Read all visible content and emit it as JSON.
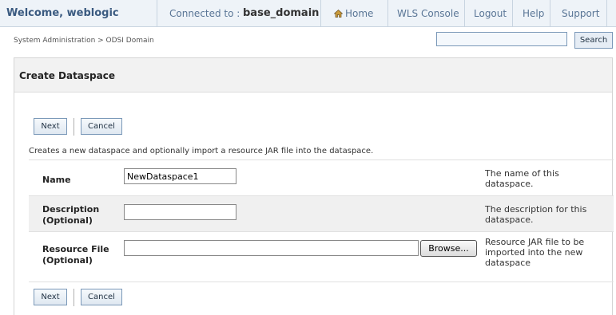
{
  "topbar": {
    "welcome_prefix": "Welcome, ",
    "username": "weblogic",
    "connected_label": "Connected to :",
    "domain": "base_domain",
    "nav": [
      "Home",
      "WLS Console",
      "Logout",
      "Help",
      "Support"
    ]
  },
  "breadcrumb": "System Administration > ODSI Domain",
  "search": {
    "value": "",
    "button_label": "Search"
  },
  "panel": {
    "title": "Create Dataspace",
    "next_label": "Next",
    "cancel_label": "Cancel",
    "description": "Creates a new dataspace and optionally import a resource JAR file into the dataspace.",
    "fields": [
      {
        "label_line1": "Name",
        "label_line2": "",
        "value": "NewDataspace1",
        "help_line1": "The name of this",
        "help_line2": "dataspace.",
        "help_line3": ""
      },
      {
        "label_line1": "Description",
        "label_line2": "(Optional)",
        "value": "",
        "help_line1": "The description for this",
        "help_line2": "dataspace.",
        "help_line3": ""
      },
      {
        "label_line1": "Resource File",
        "label_line2": "(Optional)",
        "value": "",
        "help_line1": "Resource JAR file to be",
        "help_line2": "imported into the new",
        "help_line3": "dataspace"
      }
    ],
    "browse_label": "Browse..."
  },
  "colors": {
    "topbar_bg": "#eef3f8",
    "link": "#5a7696",
    "button_border": "#7a98b8"
  },
  "icons": {
    "home": "home-icon"
  }
}
